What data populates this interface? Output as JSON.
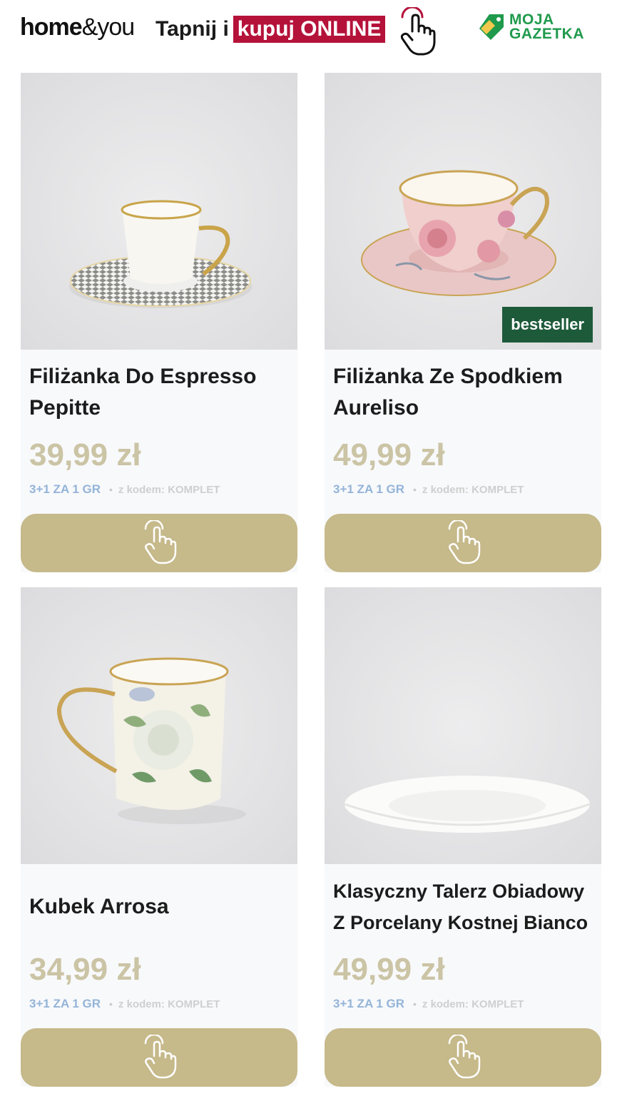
{
  "header": {
    "brand_bold": "home",
    "brand_light": "&you",
    "tagline_lead": "Tapnij i",
    "tagline_cta": "kupuj ONLINE",
    "mg_line1": "MOJA",
    "mg_line2": "GAZETKA"
  },
  "colors": {
    "cta_red": "#b5123a",
    "price_gold": "#cbc4a5",
    "button_gold": "#c6b98a",
    "deal_blue": "#94b4d8",
    "badge_green": "#1d5a3a",
    "logo_green": "#1f9a4c"
  },
  "products": [
    {
      "name_line1": "Filiżanka Do Espresso",
      "name_line2": "Pepitte",
      "price": "39,99 zł",
      "deal": "3+1 ZA 1 GR",
      "code": "z kodem: KOMPLET",
      "badge": "",
      "icon": "tap-hand-icon"
    },
    {
      "name_line1": "Filiżanka Ze Spodkiem",
      "name_line2": "Aureliso",
      "price": "49,99 zł",
      "deal": "3+1 ZA 1 GR",
      "code": "z kodem: KOMPLET",
      "badge": "bestseller",
      "icon": "tap-hand-icon"
    },
    {
      "name_line1": "Kubek Arrosa",
      "name_line2": "",
      "price": "34,99 zł",
      "deal": "3+1 ZA 1 GR",
      "code": "z kodem: KOMPLET",
      "badge": "",
      "icon": "tap-hand-icon"
    },
    {
      "name_line1": "Klasyczny Talerz Obiadowy",
      "name_line2": "Z Porcelany Kostnej Bianco",
      "price": "49,99 zł",
      "deal": "3+1 ZA 1 GR",
      "code": "z kodem: KOMPLET",
      "badge": "",
      "icon": "tap-hand-icon"
    }
  ]
}
